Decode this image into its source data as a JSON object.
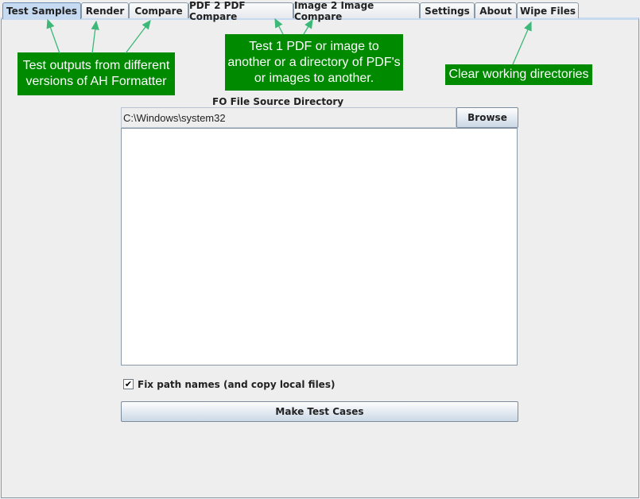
{
  "tabs": [
    "Test Samples",
    "Render",
    "Compare",
    "PDF 2 PDF Compare",
    "Image 2 Image Compare",
    "Settings",
    "About",
    "Wipe Files"
  ],
  "active_tab": "Test Samples",
  "callouts": {
    "versions": [
      "Test outputs from different",
      "versions of AH Formatter"
    ],
    "compare": [
      "Test 1 PDF or image to",
      "another or a directory of PDF's",
      "or images to another."
    ],
    "wipe": [
      "Clear working directories"
    ]
  },
  "callout_color": "#008a00",
  "source": {
    "label": "FO File Source Directory",
    "value": "C:\\Windows\\system32",
    "browse_label": "Browse"
  },
  "fix_paths": {
    "label": "Fix path names (and copy local files)",
    "checked": true
  },
  "make_button": "Make Test Cases"
}
